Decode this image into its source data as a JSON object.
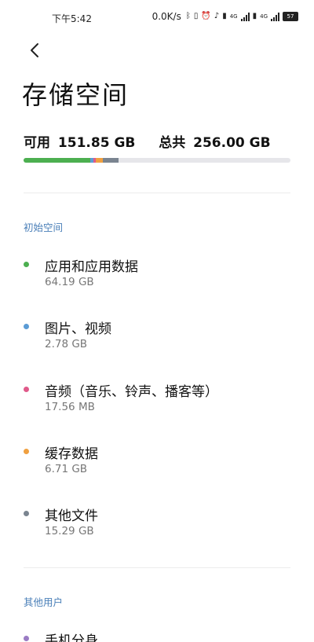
{
  "status_bar": {
    "time": "下午5:42",
    "network_speed": "0.0K/s",
    "battery": "57",
    "net_type_1": "4G",
    "net_type_2": "4G"
  },
  "header": {
    "back_icon": "chevron-left-icon",
    "title": "存储空间"
  },
  "summary": {
    "available_label": "可用",
    "available_value": "151.85 GB",
    "total_label": "总共",
    "total_value": "256.00 GB"
  },
  "storage_bar": {
    "used_fraction": 0.4068,
    "segments": [
      {
        "name": "apps",
        "fraction": 0.2508,
        "color": "#4caf50"
      },
      {
        "name": "images",
        "fraction": 0.0109,
        "color": "#5b9bd5"
      },
      {
        "name": "audio",
        "fraction": 0.0001,
        "color": "#e05a8a"
      },
      {
        "name": "cache",
        "fraction": 0.0262,
        "color": "#f0a040"
      },
      {
        "name": "other",
        "fraction": 0.0597,
        "color": "#7a8490"
      }
    ],
    "track_color": "#e6e6ea"
  },
  "sections": {
    "initial_space": {
      "header": "初始空间",
      "items": [
        {
          "label": "应用和应用数据",
          "size": "64.19 GB",
          "color": "#4caf50"
        },
        {
          "label": "图片、视频",
          "size": "2.78 GB",
          "color": "#5b9bd5"
        },
        {
          "label": "音频（音乐、铃声、播客等）",
          "size": "17.56 MB",
          "color": "#e05a8a"
        },
        {
          "label": "缓存数据",
          "size": "6.71 GB",
          "color": "#f0a040"
        },
        {
          "label": "其他文件",
          "size": "15.29 GB",
          "color": "#7a8490"
        }
      ]
    },
    "other_users": {
      "header": "其他用户",
      "items": [
        {
          "label": "手机分身",
          "color": "#9a7bc4"
        }
      ]
    }
  }
}
